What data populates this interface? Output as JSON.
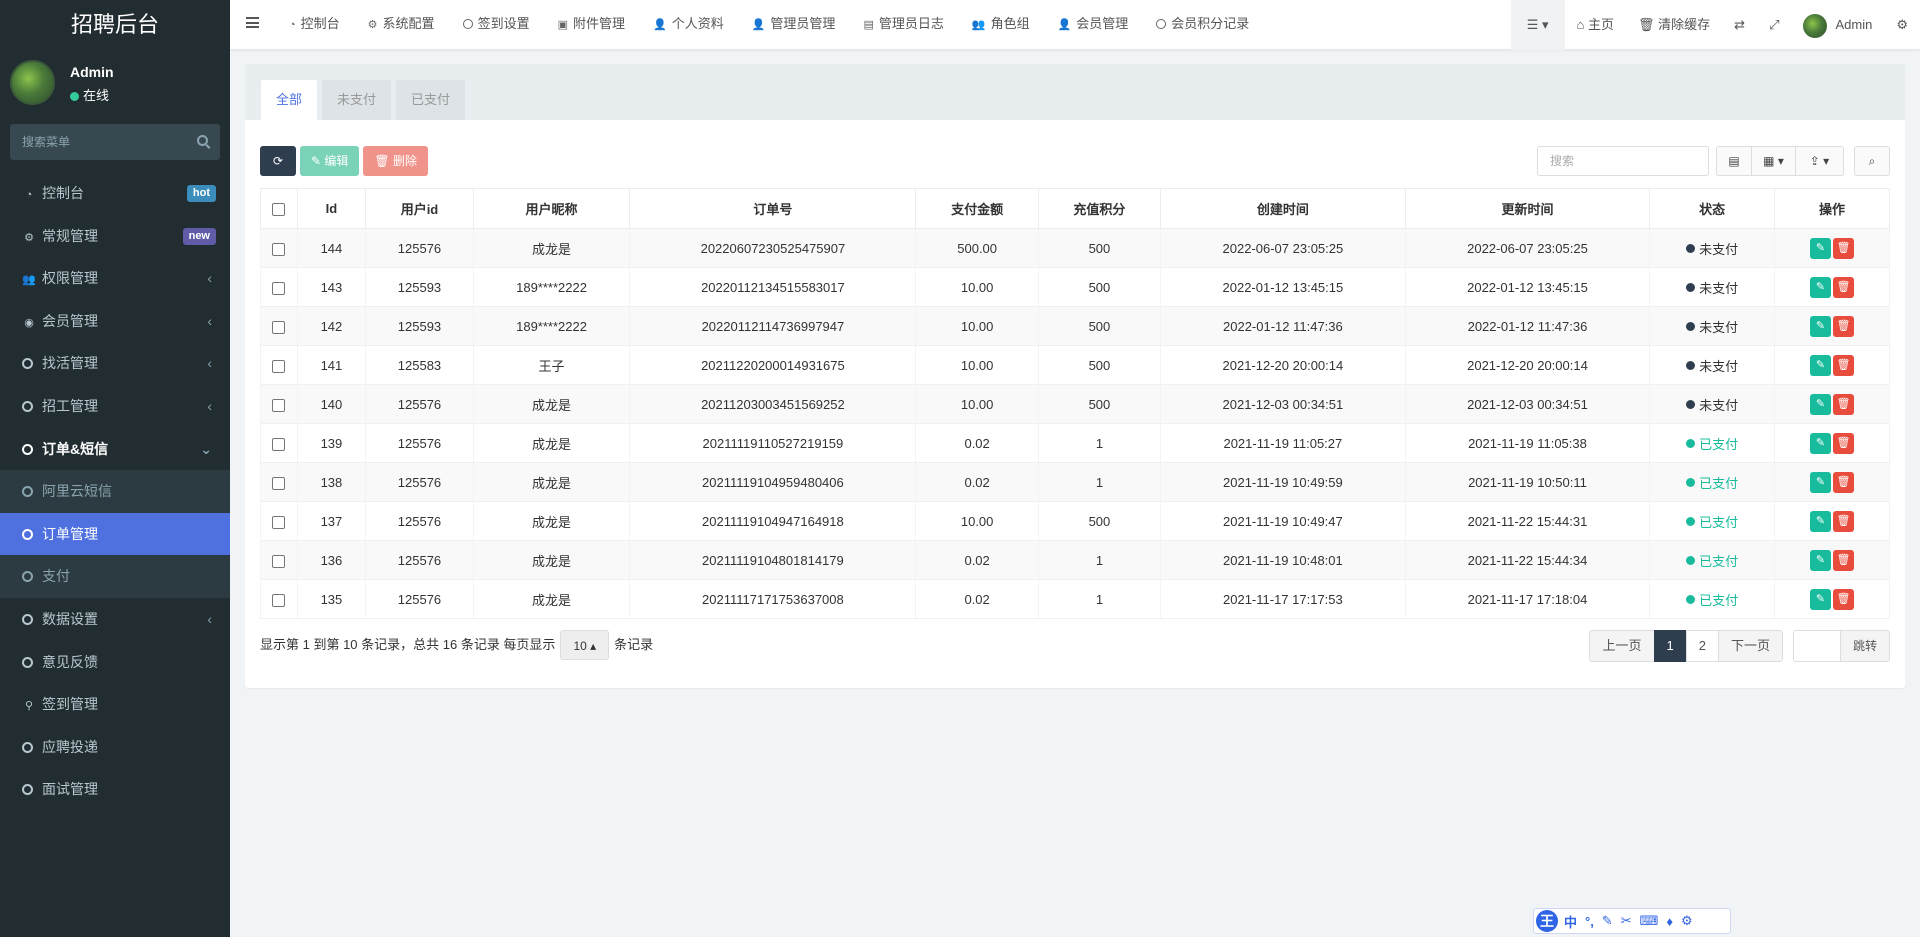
{
  "sidebar": {
    "brand": "招聘后台",
    "user": {
      "name": "Admin",
      "status": "在线"
    },
    "search_placeholder": "搜索菜单",
    "items": [
      {
        "label": "控制台",
        "icon": "dashboard-icon",
        "badge": "hot",
        "badge_color": "#3c8dbc"
      },
      {
        "label": "常规管理",
        "icon": "cogs-icon",
        "badge": "new",
        "badge_color": "#605ca8"
      },
      {
        "label": "权限管理",
        "icon": "group-icon"
      },
      {
        "label": "会员管理",
        "icon": "user-circle-icon"
      },
      {
        "label": "找活管理",
        "icon": "circle-icon"
      },
      {
        "label": "招工管理",
        "icon": "circle-icon"
      },
      {
        "label": "订单&短信",
        "icon": "circle-icon"
      }
    ],
    "subitems": [
      {
        "label": "阿里云短信"
      },
      {
        "label": "订单管理"
      },
      {
        "label": "支付"
      }
    ],
    "items_after": [
      {
        "label": "数据设置",
        "icon": "circle-icon"
      },
      {
        "label": "意见反馈",
        "icon": "circle-icon"
      },
      {
        "label": "签到管理",
        "icon": "map-marker-icon"
      },
      {
        "label": "应聘投递",
        "icon": "circle-icon"
      },
      {
        "label": "面试管理",
        "icon": "circle-icon"
      }
    ]
  },
  "topbar": {
    "tabs": [
      {
        "label": "控制台",
        "icon": "dashboard-icon"
      },
      {
        "label": "系统配置",
        "icon": "cog-icon"
      },
      {
        "label": "签到设置",
        "icon": "circle-icon"
      },
      {
        "label": "附件管理",
        "icon": "file-image-icon"
      },
      {
        "label": "个人资料",
        "icon": "user-icon"
      },
      {
        "label": "管理员管理",
        "icon": "user-icon"
      },
      {
        "label": "管理员日志",
        "icon": "list-alt-icon"
      },
      {
        "label": "角色组",
        "icon": "group-icon"
      },
      {
        "label": "会员管理",
        "icon": "user-icon"
      },
      {
        "label": "会员积分记录",
        "icon": "circle-icon"
      }
    ],
    "home_label": "主页",
    "clear_cache_label": "清除缓存",
    "admin_label": "Admin"
  },
  "content": {
    "tabs": [
      "全部",
      "未支付",
      "已支付"
    ],
    "toolbar": {
      "edit_label": "编辑",
      "delete_label": "删除",
      "search_placeholder": "搜索"
    },
    "columns": [
      "Id",
      "用户id",
      "用户昵称",
      "订单号",
      "支付金额",
      "充值积分",
      "创建时间",
      "更新时间",
      "状态",
      "操作"
    ],
    "rows": [
      {
        "id": "144",
        "uid": "125576",
        "nick": "成龙是",
        "order": "20220607230525475907",
        "amount": "500.00",
        "points": "500",
        "created": "2022-06-07 23:05:25",
        "updated": "2022-06-07 23:05:25",
        "status": "未支付",
        "paid": false
      },
      {
        "id": "143",
        "uid": "125593",
        "nick": "189****2222",
        "order": "20220112134515583017",
        "amount": "10.00",
        "points": "500",
        "created": "2022-01-12 13:45:15",
        "updated": "2022-01-12 13:45:15",
        "status": "未支付",
        "paid": false
      },
      {
        "id": "142",
        "uid": "125593",
        "nick": "189****2222",
        "order": "20220112114736997947",
        "amount": "10.00",
        "points": "500",
        "created": "2022-01-12 11:47:36",
        "updated": "2022-01-12 11:47:36",
        "status": "未支付",
        "paid": false
      },
      {
        "id": "141",
        "uid": "125583",
        "nick": "王子",
        "order": "20211220200014931675",
        "amount": "10.00",
        "points": "500",
        "created": "2021-12-20 20:00:14",
        "updated": "2021-12-20 20:00:14",
        "status": "未支付",
        "paid": false
      },
      {
        "id": "140",
        "uid": "125576",
        "nick": "成龙是",
        "order": "20211203003451569252",
        "amount": "10.00",
        "points": "500",
        "created": "2021-12-03 00:34:51",
        "updated": "2021-12-03 00:34:51",
        "status": "未支付",
        "paid": false
      },
      {
        "id": "139",
        "uid": "125576",
        "nick": "成龙是",
        "order": "20211119110527219159",
        "amount": "0.02",
        "points": "1",
        "created": "2021-11-19 11:05:27",
        "updated": "2021-11-19 11:05:38",
        "status": "已支付",
        "paid": true
      },
      {
        "id": "138",
        "uid": "125576",
        "nick": "成龙是",
        "order": "20211119104959480406",
        "amount": "0.02",
        "points": "1",
        "created": "2021-11-19 10:49:59",
        "updated": "2021-11-19 10:50:11",
        "status": "已支付",
        "paid": true
      },
      {
        "id": "137",
        "uid": "125576",
        "nick": "成龙是",
        "order": "20211119104947164918",
        "amount": "10.00",
        "points": "500",
        "created": "2021-11-19 10:49:47",
        "updated": "2021-11-22 15:44:31",
        "status": "已支付",
        "paid": true
      },
      {
        "id": "136",
        "uid": "125576",
        "nick": "成龙是",
        "order": "20211119104801814179",
        "amount": "0.02",
        "points": "1",
        "created": "2021-11-19 10:48:01",
        "updated": "2021-11-22 15:44:34",
        "status": "已支付",
        "paid": true
      },
      {
        "id": "135",
        "uid": "125576",
        "nick": "成龙是",
        "order": "20211117171753637008",
        "amount": "0.02",
        "points": "1",
        "created": "2021-11-17 17:17:53",
        "updated": "2021-11-17 17:18:04",
        "status": "已支付",
        "paid": true
      }
    ],
    "footer": {
      "summary": "显示第 1 到第 10 条记录，总共 16 条记录 每页显示",
      "page_size": "10",
      "suffix": "条记录",
      "prev": "上一页",
      "pages": [
        "1",
        "2"
      ],
      "next": "下一页",
      "jump": "跳转"
    }
  },
  "ime_bar": {
    "logo": "王",
    "mode": "中"
  }
}
